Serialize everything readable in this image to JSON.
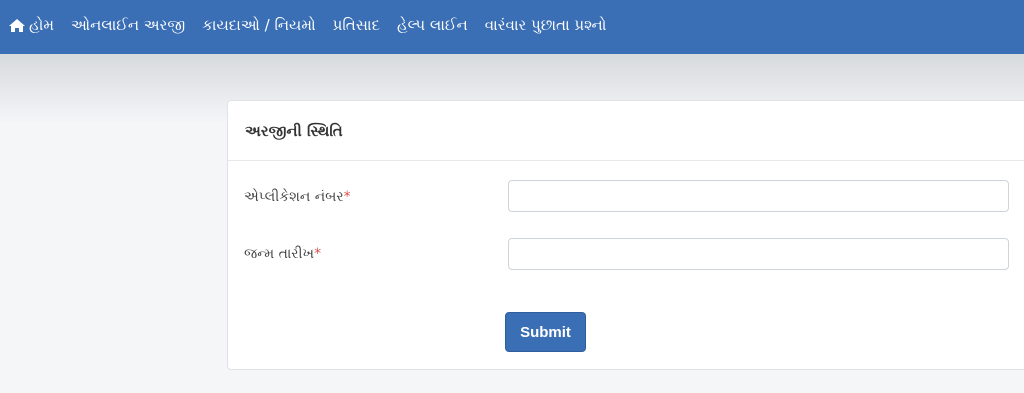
{
  "nav": {
    "items": [
      {
        "label": "હોમ",
        "icon": "home-icon"
      },
      {
        "label": "ઓનલાઈન અરજી"
      },
      {
        "label": "કાયદાઓ / નિયમો"
      },
      {
        "label": "પ્રતિસાદ"
      },
      {
        "label": "હેલ્પ લાઈન"
      },
      {
        "label": "વારંવાર પુછાતા પ્રશ્નો"
      }
    ]
  },
  "card": {
    "title": "અરજીની સ્થિતિ",
    "fields": [
      {
        "label": "એપ્લીકેશન નંબર",
        "required_mark": "*",
        "value": ""
      },
      {
        "label": "જન્મ તારીખ",
        "required_mark": "*",
        "value": ""
      }
    ],
    "submit_label": "Submit"
  },
  "colors": {
    "navbar": "#3a6eb5",
    "button": "#3a6eb5",
    "required": "#d9534f"
  }
}
